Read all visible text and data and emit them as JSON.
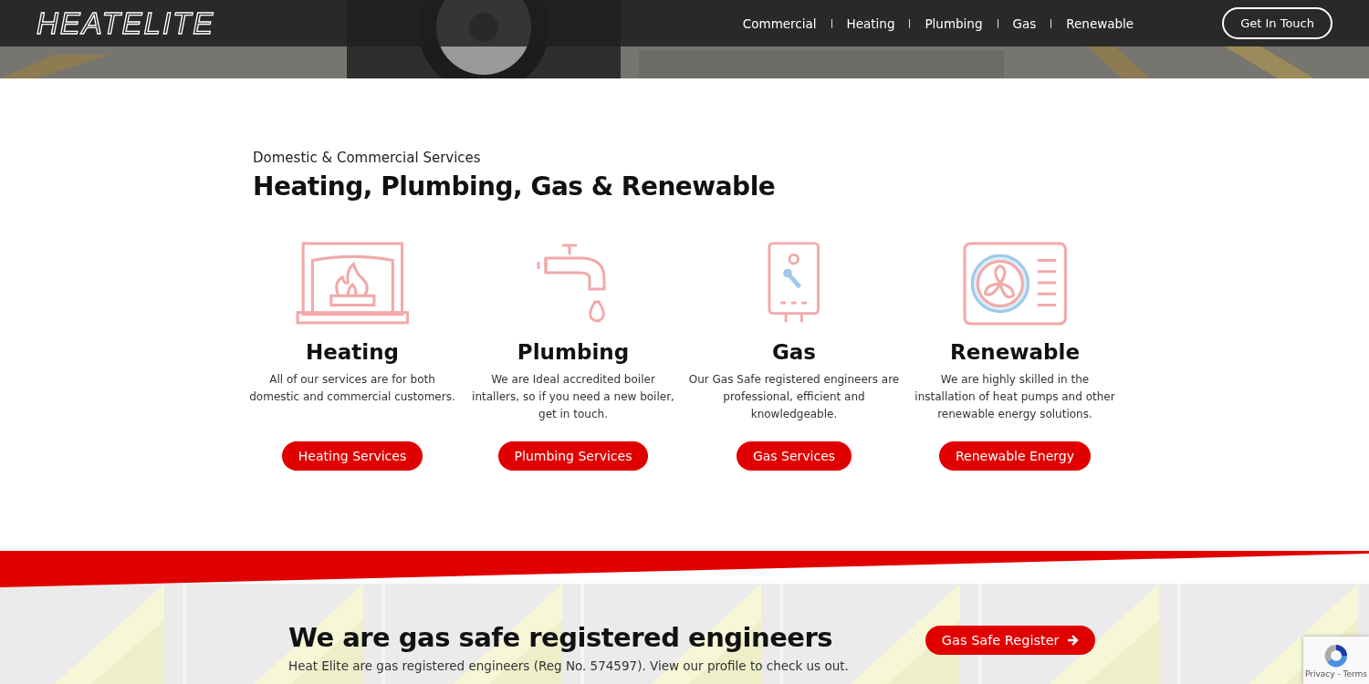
{
  "header": {
    "logo": "HEATELITE",
    "nav": [
      {
        "label": "Commercial"
      },
      {
        "label": "Heating"
      },
      {
        "label": "Plumbing"
      },
      {
        "label": "Gas"
      },
      {
        "label": "Renewable"
      }
    ],
    "cta": "Get In Touch"
  },
  "intro": {
    "eyebrow": "Domestic & Commercial Services",
    "title": "Heating, Plumbing, Gas & Renewable"
  },
  "services": [
    {
      "kind": "fireplace",
      "title": "Heating",
      "text": "All of our services are for both domestic and commercial customers.",
      "button": "Heating Services"
    },
    {
      "kind": "tap",
      "title": "Plumbing",
      "text": "We are Ideal accredited boiler intallers, so if you need a new boiler, get in touch.",
      "button": "Plumbing Services"
    },
    {
      "kind": "boiler",
      "title": "Gas",
      "text": "Our Gas Safe registered engineers are professional, efficient and knowledgeable.",
      "button": "Gas Services"
    },
    {
      "kind": "heatpump",
      "title": "Renewable",
      "text": "We are highly skilled in the installation of heat pumps and other renewable energy solutions.",
      "button": "Renewable Energy"
    }
  ],
  "gas_safe": {
    "title": "We are gas safe registered engineers",
    "text": "Heat Elite are gas registered engineers (Reg No. 574597). View our profile to check us out.",
    "button": "Gas Safe Register"
  },
  "recaptcha": {
    "links": "Privacy - Terms"
  }
}
